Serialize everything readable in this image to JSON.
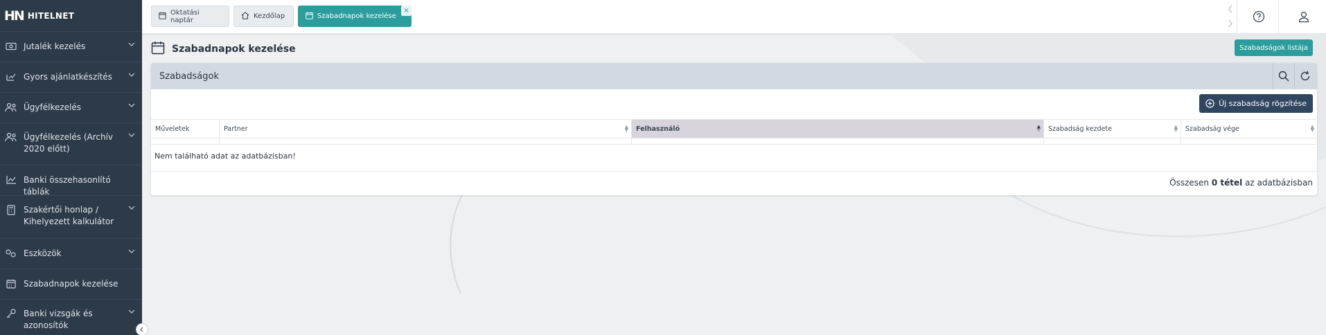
{
  "brand": {
    "mark": "HN",
    "name": "HITELNET"
  },
  "sidebar": {
    "items": [
      {
        "label": "Jutalék kezelés",
        "icon": "money-icon",
        "chevron": true
      },
      {
        "label": "Gyors ajánlatkészítés",
        "icon": "edit-chart-icon",
        "chevron": true
      },
      {
        "label": "Ügyfélkezelés",
        "icon": "users-icon",
        "chevron": true
      },
      {
        "label": "Ügyfélkezelés (Archív 2020 előtt)",
        "icon": "users-icon",
        "chevron": true
      },
      {
        "label": "Banki összehasonlító táblák",
        "icon": "line-chart-icon",
        "chevron": false
      },
      {
        "label": "Szakértői honlap / Kihelyezett kalkulátor",
        "icon": "calculator-icon",
        "chevron": true
      },
      {
        "label": "Eszközök",
        "icon": "tools-icon",
        "chevron": true
      },
      {
        "label": "Szabadnapok kezelése",
        "icon": "calendar-icon",
        "chevron": false
      },
      {
        "label": "Banki vizsgák és azonosítók",
        "icon": "key-icon",
        "chevron": true
      }
    ]
  },
  "tabs": [
    {
      "label": "Oktatási naptár",
      "icon": "calendar-icon",
      "active": false
    },
    {
      "label": "Kezdőlap",
      "icon": "home-icon",
      "active": false
    },
    {
      "label": "Szabadnapok kezelése",
      "icon": "calendar-icon",
      "active": true,
      "close": "×"
    }
  ],
  "page": {
    "title": "Szabadnapok kezelése",
    "list_button": "Szabadságok listája"
  },
  "card": {
    "title": "Szabadságok",
    "new_button": "Új szabadság rögzítése",
    "columns": [
      "Műveletek",
      "Partner",
      "Felhasználó",
      "Szabadság kezdete",
      "Szabadság vége"
    ],
    "sorted_column": "Felhasználó",
    "empty_text": "Nem található adat az adatbázisban!",
    "total_prefix": "Összesen",
    "total_count": "0 tétel",
    "total_suffix": "az adatbázisban"
  },
  "colors": {
    "sidebar": "#2d3a48",
    "accent": "#2a9d9c",
    "primary_button": "#2f4560",
    "card_header": "#d2d9e1"
  }
}
